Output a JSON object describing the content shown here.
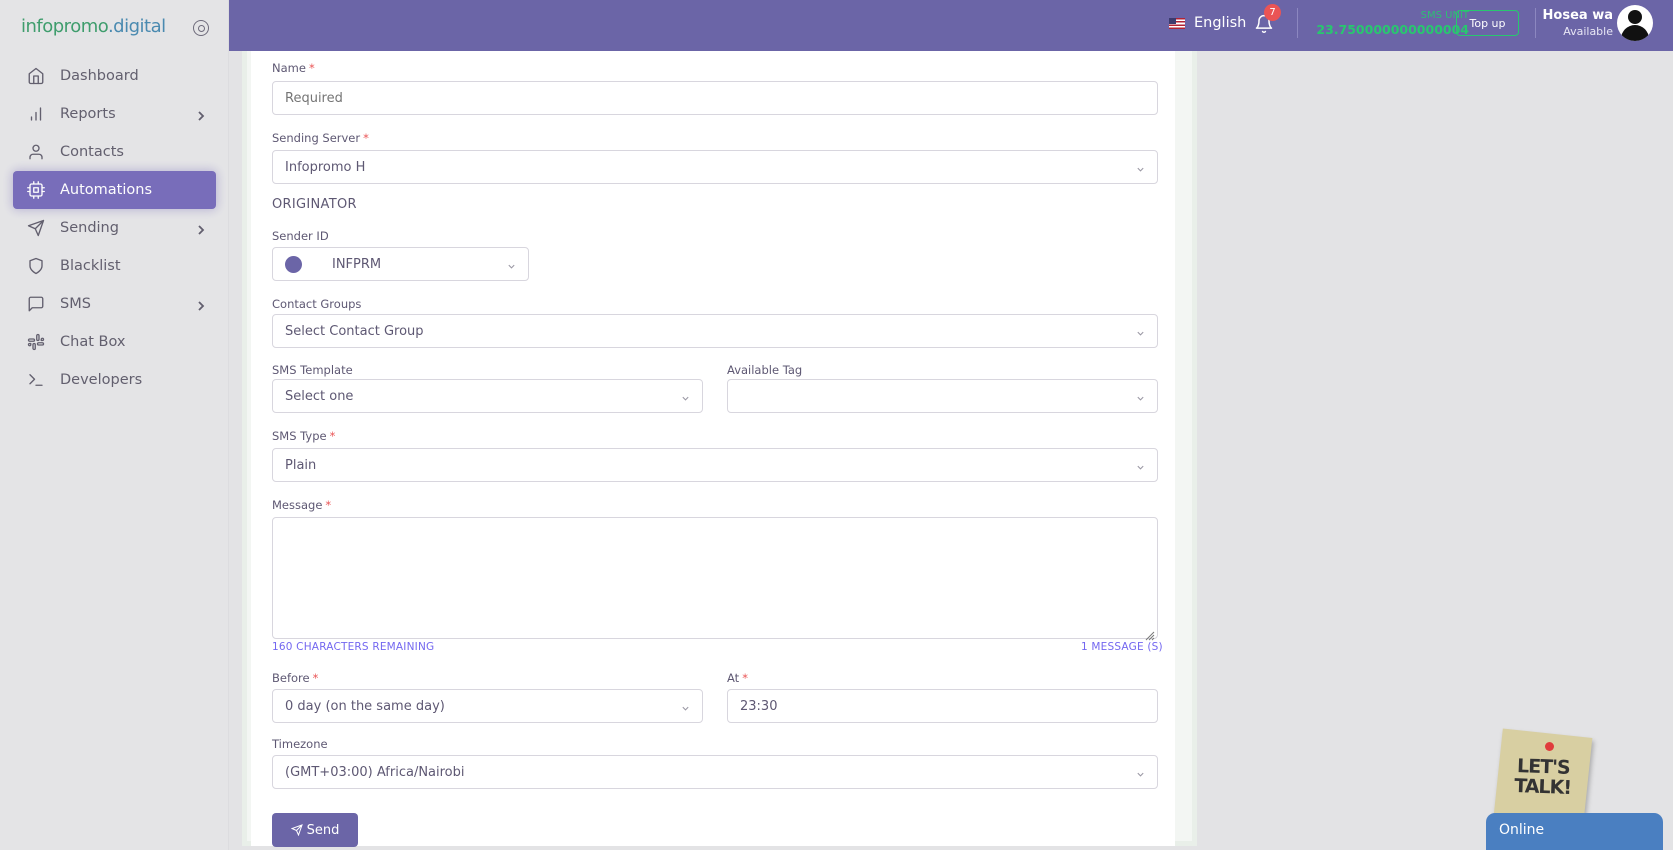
{
  "brand": {
    "name_part1": "infopromo",
    "name_part2": ".digital"
  },
  "sidebar": {
    "items": [
      {
        "label": "Dashboard",
        "icon": "home-icon",
        "has_children": false,
        "active": false
      },
      {
        "label": "Reports",
        "icon": "bar-chart-icon",
        "has_children": true,
        "active": false
      },
      {
        "label": "Contacts",
        "icon": "user-icon",
        "has_children": false,
        "active": false
      },
      {
        "label": "Automations",
        "icon": "cpu-icon",
        "has_children": false,
        "active": true
      },
      {
        "label": "Sending",
        "icon": "send-icon",
        "has_children": true,
        "active": false
      },
      {
        "label": "Blacklist",
        "icon": "shield-icon",
        "has_children": false,
        "active": false
      },
      {
        "label": "SMS",
        "icon": "message-square-icon",
        "has_children": true,
        "active": false
      },
      {
        "label": "Chat Box",
        "icon": "slack-icon",
        "has_children": false,
        "active": false
      },
      {
        "label": "Developers",
        "icon": "terminal-icon",
        "has_children": false,
        "active": false
      }
    ]
  },
  "header": {
    "language": "English",
    "notification_count": "7",
    "sms_unit_label": "SMS UNIT",
    "sms_unit_value": "23.750000000000004",
    "topup_label": "Top up",
    "user_name": "Hosea wa",
    "user_status": "Available"
  },
  "form": {
    "name_label": "Name",
    "name_placeholder": "Required",
    "server_label": "Sending Server",
    "server_value": "Infopromo H",
    "originator_heading": "ORIGINATOR",
    "sender_id_label": "Sender ID",
    "sender_id_value": "INFPRM",
    "contact_groups_label": "Contact Groups",
    "contact_groups_value": "Select Contact Group",
    "sms_template_label": "SMS Template",
    "sms_template_value": "Select one",
    "available_tag_label": "Available Tag",
    "available_tag_value": "",
    "sms_type_label": "SMS Type",
    "sms_type_value": "Plain",
    "message_label": "Message",
    "message_value": "",
    "chars_remaining": "160 CHARACTERS REMAINING",
    "message_count": "1 MESSAGE (S)",
    "before_label": "Before",
    "before_value": "0 day (on the same day)",
    "at_label": "At",
    "at_value": "23:30",
    "timezone_label": "Timezone",
    "timezone_value": "(GMT+03:00) Africa/Nairobi",
    "send_label": "Send",
    "required_mark": "*"
  },
  "chat_widget": {
    "sticker_text": "LET'S TALK!",
    "status": "Online"
  },
  "colors": {
    "primary": "#6b65a7",
    "success": "#28c76f",
    "danger": "#ea5455"
  }
}
